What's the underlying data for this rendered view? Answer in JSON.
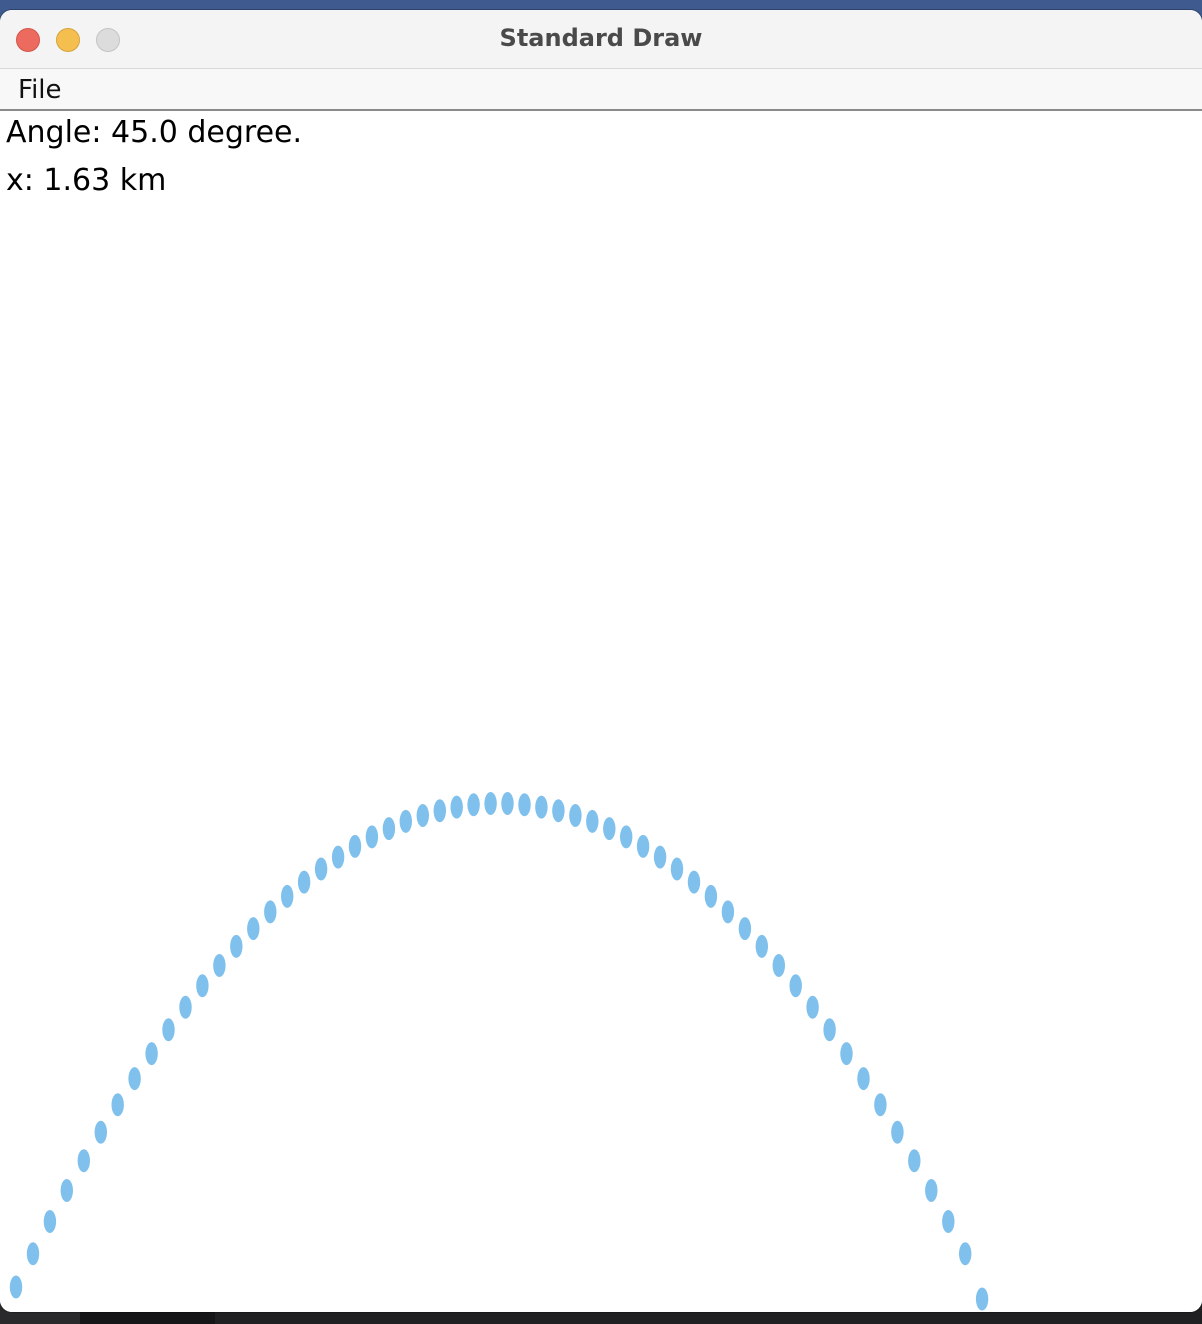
{
  "window": {
    "title": "Standard Draw"
  },
  "menubar": {
    "items": [
      {
        "label": "File"
      }
    ]
  },
  "canvas": {
    "angle_text": "Angle: 45.0 degree.",
    "x_text": "x: 1.63 km"
  },
  "trajectory": {
    "angle_deg": 45.0,
    "range_km": 1.63,
    "point_count": 58,
    "point_color": "#7fc1ec"
  },
  "colors": {
    "close": "#ed6a5e",
    "minimize": "#f5bf4f",
    "zoom": "#dcdcdc",
    "desktop": "#3e5a8f"
  }
}
